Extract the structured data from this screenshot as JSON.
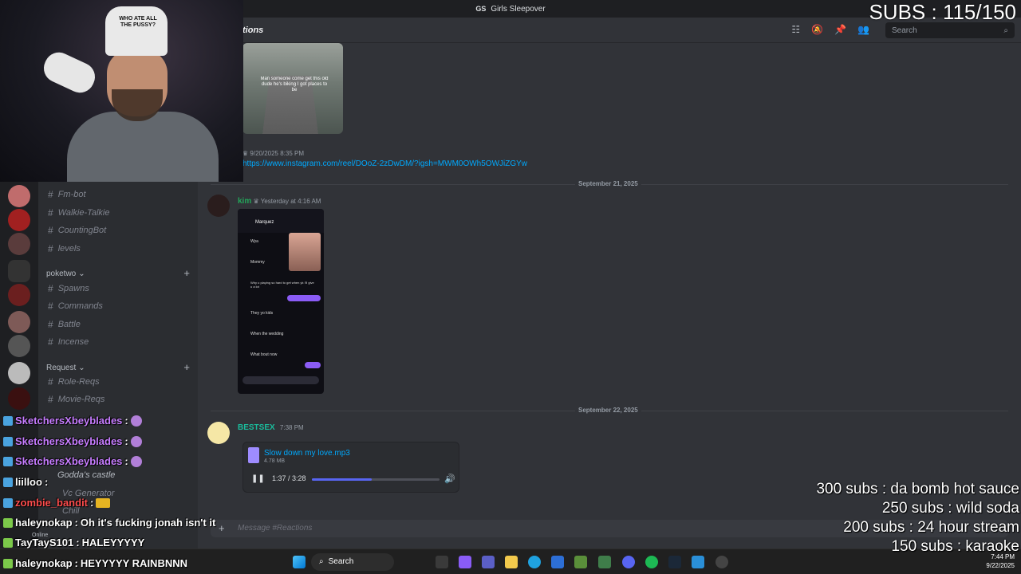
{
  "window": {
    "server_badge": "GS",
    "title": "Girls Sleepover"
  },
  "stream_overlay": {
    "subs_counter": "SUBS : 115/150",
    "goals": [
      "300 subs : da bomb hot sauce",
      "250 subs : wild soda",
      "200 subs : 24 hour stream",
      "150 subs : karaoke"
    ],
    "chat": [
      {
        "user": "SketchersXbeyblades",
        "text": "",
        "color": "#c77dff"
      },
      {
        "user": "SketchersXbeyblades",
        "text": "",
        "color": "#c77dff"
      },
      {
        "user": "SketchersXbeyblades",
        "text": "",
        "color": "#c77dff"
      },
      {
        "user": "liilloo",
        "text": "",
        "color": "#ffffff"
      },
      {
        "user": "zombie_bandit",
        "text": "",
        "color": "#ff4d4d"
      },
      {
        "user": "haleynokap",
        "text": "Oh it's fucking jonah isn't it",
        "color": "#ffffff"
      },
      {
        "user": "TayTayS101",
        "text": "HALEYYYYY",
        "color": "#ffffff"
      },
      {
        "user": "haleynokap",
        "text": "HEYYYYY RAINBNNN",
        "color": "#ffffff"
      }
    ],
    "webcam_hat_text": "WHO ATE ALL THE PUSSY?"
  },
  "sidebar": {
    "channels_top": [
      {
        "name": "Fm-bot"
      },
      {
        "name": "Walkie-Talkie"
      },
      {
        "name": "CountingBot"
      },
      {
        "name": "levels"
      }
    ],
    "categories": [
      {
        "name": "poketwo",
        "channels": [
          "Spawns",
          "Commands",
          "Battle",
          "Incense"
        ]
      },
      {
        "name": "Request",
        "channels": [
          "Role-Reqs",
          "Movie-Reqs"
        ]
      }
    ],
    "voice": {
      "channels": [
        "Godda's castle",
        "Vc Generator",
        "Chill"
      ],
      "status": "Online"
    }
  },
  "channel_header": {
    "name": "tions",
    "search_placeholder": "Search"
  },
  "messages": {
    "video_caption": "Man someone come get this old dude he's biking I got places to be",
    "first_author": "",
    "first_time": "9/20/2025 8:35 PM",
    "link": "https://www.instagram.com/reel/DOoZ-2zDwDM/?igsh=MWM0OWh5OWJiZGYw",
    "divider1": "September 21, 2025",
    "kim_author": "kim",
    "kim_time": "Yesterday at 4:16 AM",
    "screenshot": {
      "contact": "Marquez",
      "messages": [
        "Wya",
        "Mommy",
        "Why u playing so hard to get when yk I'll give u a lot",
        "Dont stand your kids",
        "They yo kids",
        "When the wedding",
        "What bout now"
      ]
    },
    "divider2": "September 22, 2025",
    "bestsex_author": "BESTSEX",
    "bestsex_time": "7:38 PM",
    "audio": {
      "filename": "Slow down my love.mp3",
      "size": "4.78 MB",
      "current": "1:37",
      "total": "3:28",
      "progress": 0.466
    },
    "composer_placeholder": "Message #Reactions"
  },
  "taskbar": {
    "search_label": "Search",
    "time": "7:44 PM",
    "date": "9/22/2025"
  },
  "colors": {
    "accent": "#5865f2",
    "link": "#00a8fc",
    "kim": "#23a55a",
    "bestsex": "#1abc9c"
  }
}
